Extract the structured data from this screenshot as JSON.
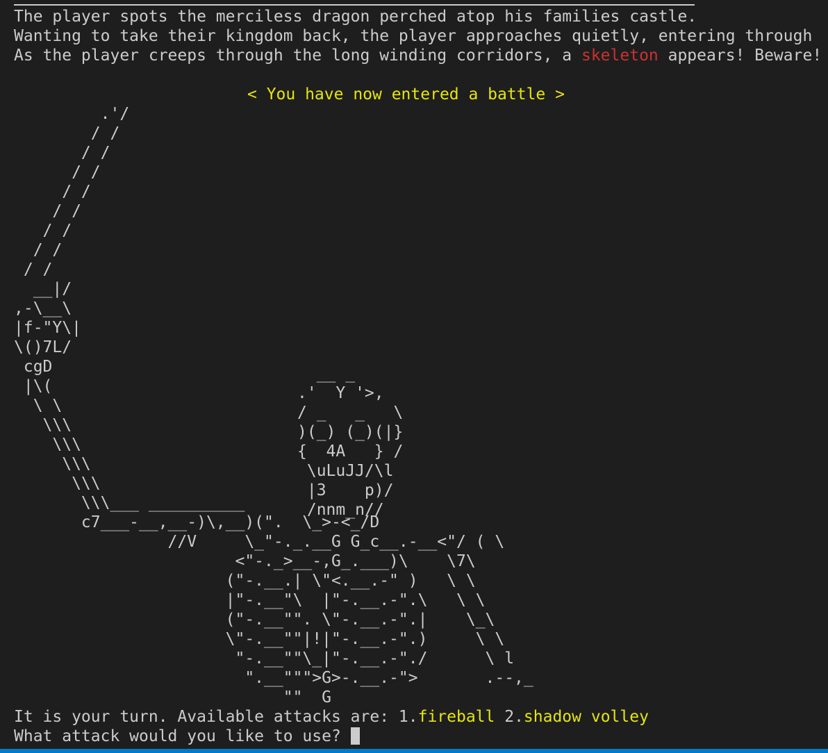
{
  "story": {
    "line1": "The player spots the merciless dragon perched atop his families castle.",
    "line2": "Wanting to take their kingdom back, the player approaches quietly, entering through",
    "line3_before": "As the player creeps through the long winding corridors, a ",
    "enemy_name": "skeleton",
    "line3_after": " appears! Beware!"
  },
  "battle_banner": "< You have now entered a battle >",
  "ascii_art": "         .'/\n        / /\n       / /\n      / /\n     / /\n    / /\n   / /\n  / /\n / /\n  __|/\n,-\\__\\\n|f-\"Y\\|\n\\()7L/\n cgD\n |\\(\n  \\ \\\n   \\\\\\\n    \\\\\\\n     \\\\\\\n      \\\\\\\n       \\\\\\___ __________\n       c7___-__,__-)\\,__)(\".  \\_>-<_/D\n                //V     \\_\"-._.__G G_c__.-__<\"/ ( \\\n                       <\"-._>__-,G_.___)\\    \\7\\\n                      (\"-.__.| \\\"<.__.-\" )   \\ \\\n                      |\"-.__\"\\  |\"-.__.-\".\\   \\ \\\n                      (\"-.__\"\". \\\"-.__.-\".|    \\_\\\n                      \\\"-.__\"\"|!|\"-.__.-\".)     \\ \\\n                       \"-.__\"\"\\_|\"-.__.-\"./      \\ l\n                        \".__\"\"\">G>-.__.-\">       .--,_\n                            \"\"  G",
  "skull_art": "  __ _\n.'  Y '>,\n/ _   _   \\\n)(_) (_)(|}\n{  4A   } /\n \\uLuJJ/\\l\n |3    p)/\n /nnm_n//",
  "prompt": {
    "turn_text": "It is your turn. Available attacks are: ",
    "attack1_num": "1.",
    "attack1_name": "fireball",
    "attack2_num": " 2.",
    "attack2_name": "shadow volley",
    "question": "What attack would you like to use? "
  },
  "colors": {
    "background": "#1e1e1e",
    "text": "#cccccc",
    "highlight_yellow": "#e5e510",
    "enemy_red": "#cd3131",
    "status_bar": "#007acc"
  }
}
